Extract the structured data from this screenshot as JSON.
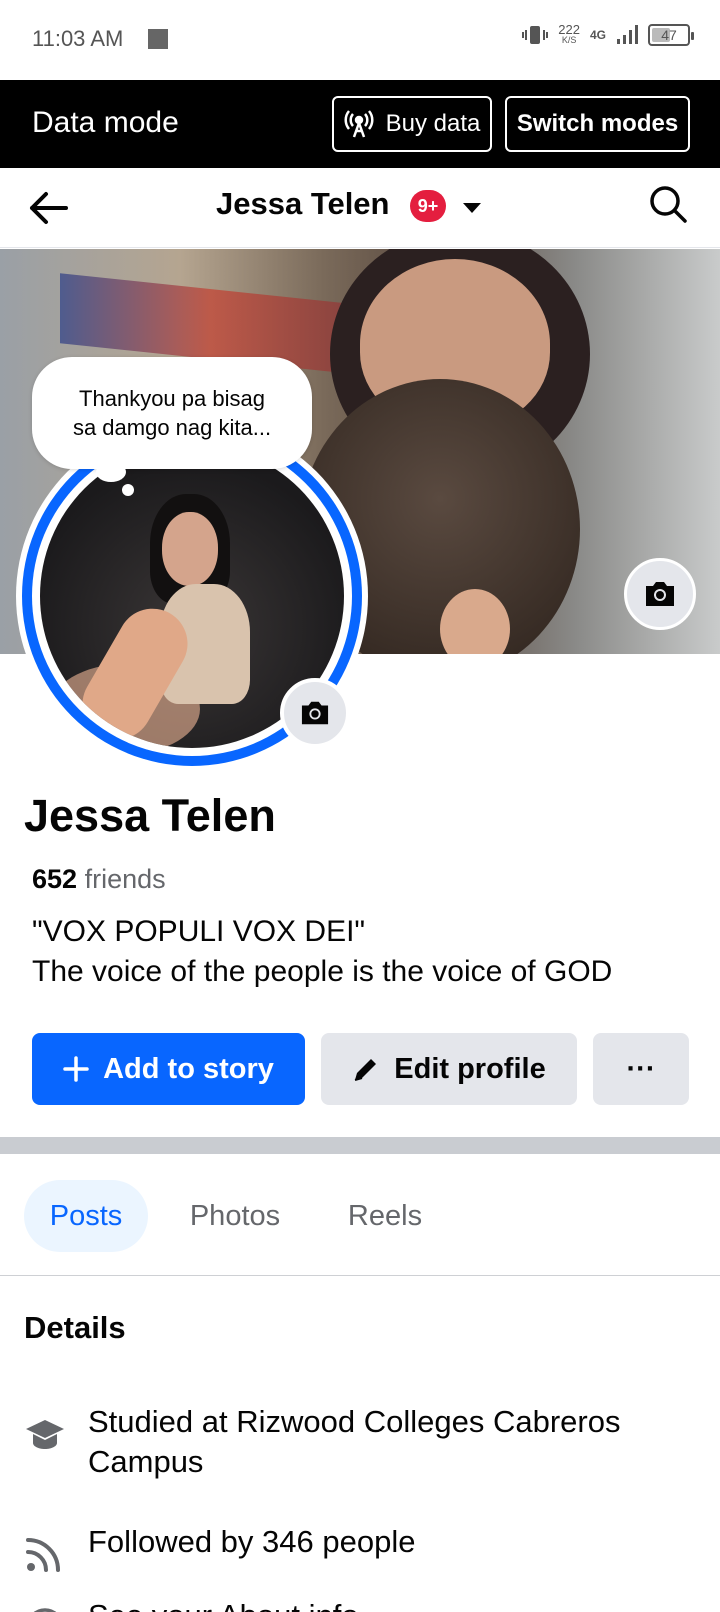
{
  "status_bar": {
    "time": "11:03 AM",
    "net_speed": "222",
    "net_unit": "K/S",
    "network": "4G",
    "battery": "47",
    "battery_level": 0.47
  },
  "data_mode": {
    "title": "Data mode",
    "buy_label": "Buy data",
    "switch_label": "Switch modes"
  },
  "header": {
    "name": "Jessa Telen",
    "badge": "9+"
  },
  "note": {
    "line1": "Thankyou pa bisag",
    "line2": "sa damgo nag kita..."
  },
  "profile": {
    "name": "Jessa Telen",
    "friends_count": "652",
    "friends_label": "friends",
    "bio_line1": "\"VOX POPULI VOX DEI\"",
    "bio_line2": "The voice of the people is the voice of GOD"
  },
  "actions": {
    "story_label": "Add to story",
    "edit_label": "Edit profile",
    "more_label": "···"
  },
  "tabs": [
    {
      "label": "Posts",
      "active": true
    },
    {
      "label": "Photos",
      "active": false
    },
    {
      "label": "Reels",
      "active": false
    }
  ],
  "details": {
    "title": "Details",
    "items": [
      {
        "icon": "graduation-cap-icon",
        "text": "Studied at Rizwood Colleges Cabreros Campus"
      },
      {
        "icon": "rss-feed-icon",
        "text": "Followed by 346 people"
      },
      {
        "icon": "info-icon",
        "text": "See your About info"
      }
    ]
  },
  "colors": {
    "brand_blue": "#0866ff",
    "badge_red": "#e41e3f",
    "button_gray": "#e4e6eb"
  }
}
